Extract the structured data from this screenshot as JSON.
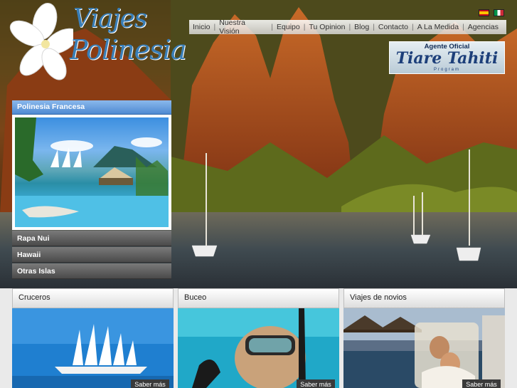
{
  "brand": {
    "line1": "Viajes",
    "line2": "Polinesia"
  },
  "languages": [
    {
      "name": "es-flag-icon"
    },
    {
      "name": "it-flag-icon"
    }
  ],
  "nav": {
    "items": [
      "Inicio",
      "Nuestra Visión",
      "Equipo",
      "Tu Opinion",
      "Blog",
      "Contacto",
      "A La Medida",
      "Agencias"
    ],
    "separator": "|"
  },
  "badge": {
    "top": "Agente Oficial",
    "title": "Tiare Tahiti",
    "sub": "Program"
  },
  "sidebar": {
    "active": "Polinesia Francesa",
    "items": [
      "Rapa Nui",
      "Hawaii",
      "Otras Islas"
    ]
  },
  "cards": [
    {
      "title": "Cruceros",
      "button": "Saber más"
    },
    {
      "title": "Buceo",
      "button": "Saber más"
    },
    {
      "title": "Viajes de novios",
      "button": "Saber más"
    }
  ],
  "colors": {
    "accent": "#4f8ad2",
    "logo": "#3a7fb8",
    "menu_gray": "#5a5a5a"
  }
}
